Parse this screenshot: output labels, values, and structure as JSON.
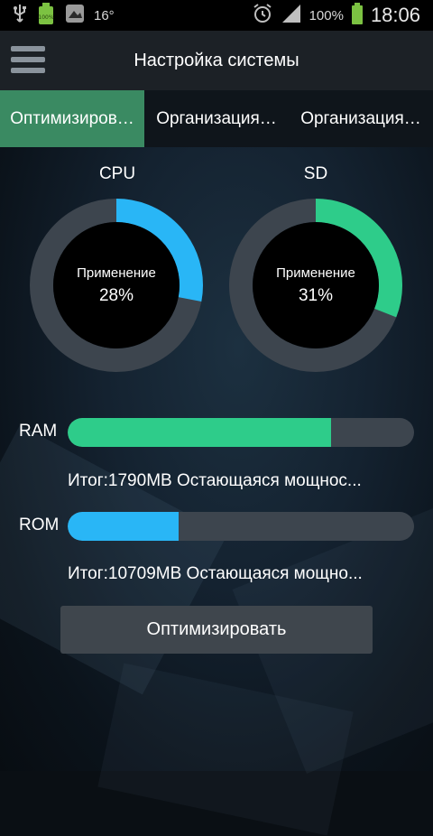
{
  "status_bar": {
    "temperature": "16°",
    "battery_percent": "100%",
    "time": "18:06",
    "icons": [
      "usb-icon",
      "battery-sd-icon",
      "image-icon",
      "alarm-icon",
      "signal-icon",
      "battery-icon"
    ]
  },
  "header": {
    "title": "Настройка системы",
    "menu_icon": "hamburger-menu-icon"
  },
  "tabs": [
    {
      "label": "Оптимизиров…",
      "active": true
    },
    {
      "label": "Организация…",
      "active": false
    },
    {
      "label": "Организация…",
      "active": false
    }
  ],
  "gauges": [
    {
      "label": "CPU",
      "caption": "Применение",
      "value_text": "28%",
      "value": 0.28,
      "color": "#29b6f6"
    },
    {
      "label": "SD",
      "caption": "Применение",
      "value_text": "31%",
      "value": 0.31,
      "color": "#2ecc8a"
    }
  ],
  "bars": [
    {
      "label": "RAM",
      "value": 0.76,
      "color": "#2ecc8a",
      "info": "Итог:1790MB Остающаяся мощнос..."
    },
    {
      "label": "ROM",
      "value": 0.32,
      "color": "#29b6f6",
      "info": "Итог:10709MB Остающаяся мощно..."
    }
  ],
  "optimize_button": {
    "label": "Оптимизировать"
  },
  "colors": {
    "accent_green": "#2ecc8a",
    "accent_blue": "#29b6f6",
    "tab_active": "#3a8a62",
    "track": "#3d454e"
  }
}
